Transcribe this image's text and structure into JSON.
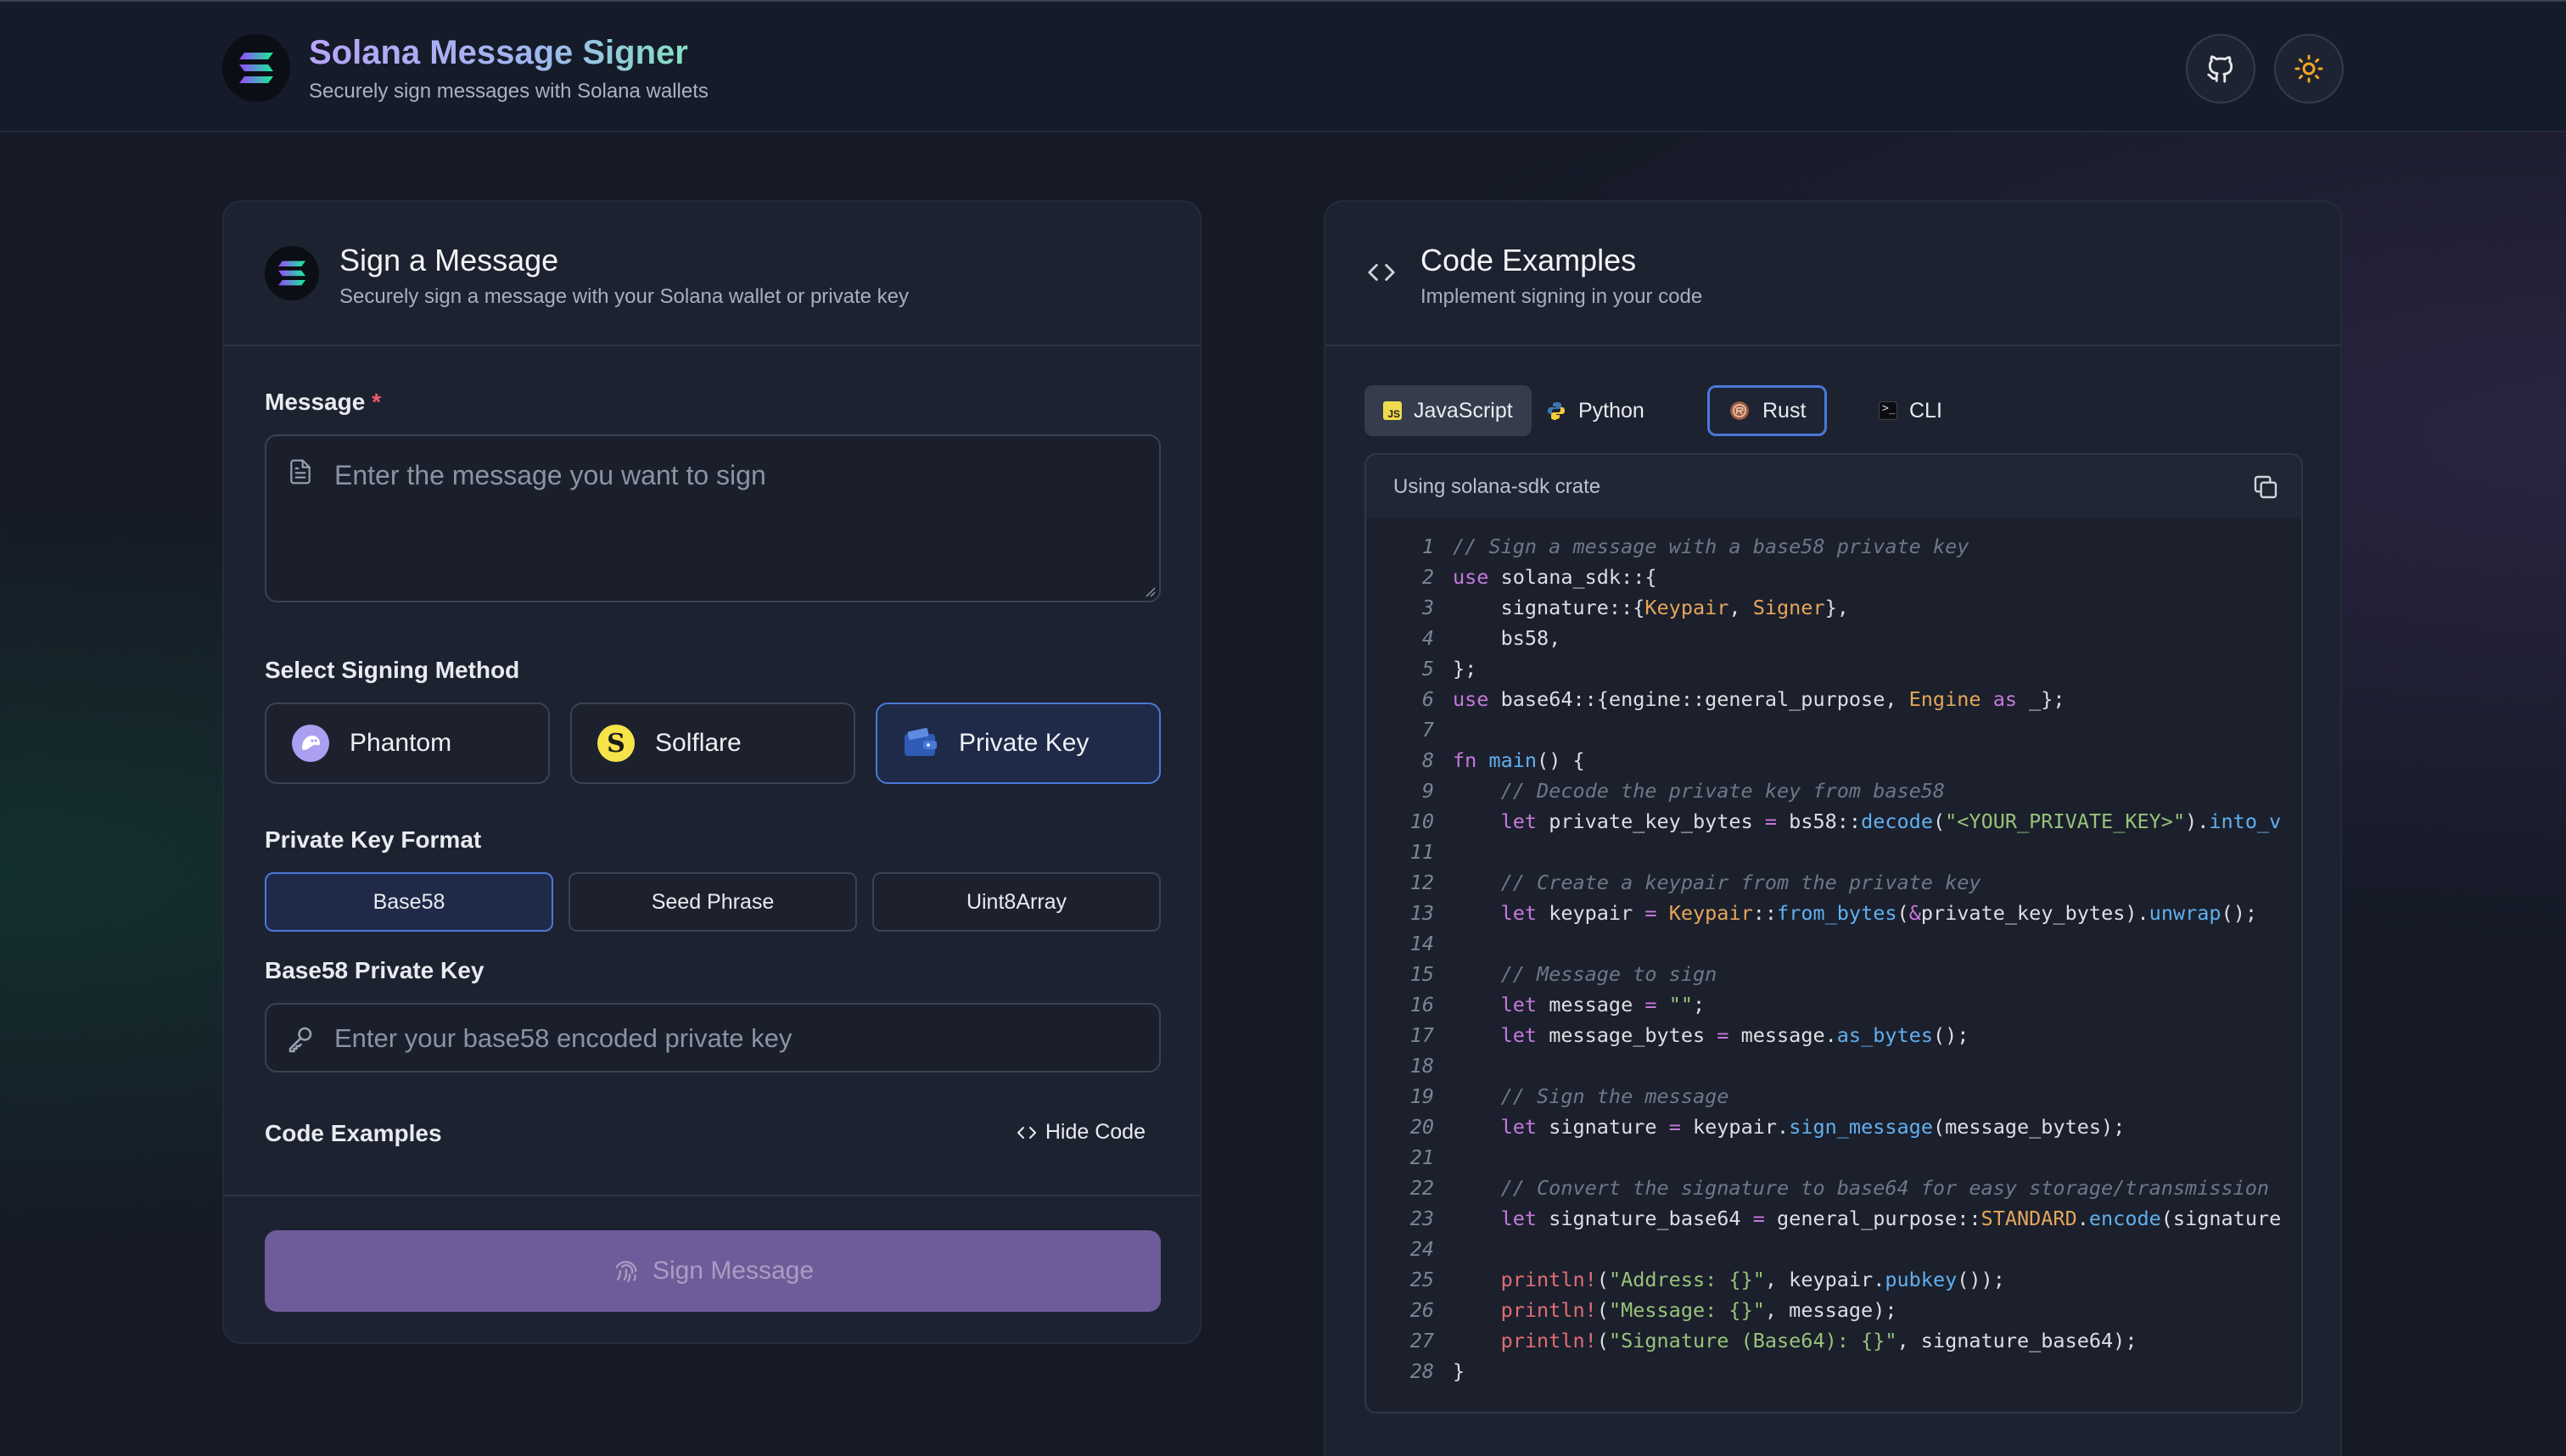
{
  "header": {
    "title": "Solana Message Signer",
    "subtitle": "Securely sign messages with Solana wallets",
    "github_icon": "github-icon",
    "theme_icon": "sun-icon"
  },
  "sign_card": {
    "title": "Sign a Message",
    "subtitle": "Securely sign a message with your Solana wallet or private key",
    "message_label": "Message",
    "required_mark": "*",
    "message_placeholder": "Enter the message you want to sign",
    "method_label": "Select Signing Method",
    "methods": [
      {
        "label": "Phantom",
        "icon": "phantom-icon"
      },
      {
        "label": "Solflare",
        "icon": "solflare-icon"
      },
      {
        "label": "Private Key",
        "icon": "wallet-icon",
        "selected": true
      }
    ],
    "format_label": "Private Key Format",
    "formats": [
      {
        "label": "Base58",
        "selected": true
      },
      {
        "label": "Seed Phrase"
      },
      {
        "label": "Uint8Array"
      }
    ],
    "key_label": "Base58 Private Key",
    "key_placeholder": "Enter your base58 encoded private key",
    "code_examples_label": "Code Examples",
    "hide_code_label": "Hide Code",
    "sign_button": "Sign Message"
  },
  "code_card": {
    "title": "Code Examples",
    "subtitle": "Implement signing in your code",
    "tabs": [
      {
        "label": "JavaScript",
        "icon": "javascript-icon"
      },
      {
        "label": "Python",
        "icon": "python-icon"
      },
      {
        "label": "Rust",
        "icon": "rust-icon",
        "selected": true
      },
      {
        "label": "CLI",
        "icon": "terminal-icon"
      }
    ],
    "caption": "Using solana-sdk crate",
    "lines": [
      [
        [
          "cm",
          "// Sign a message with a base58 private key"
        ]
      ],
      [
        [
          "kw",
          "use"
        ],
        [
          "tx",
          " solana_sdk::{"
        ]
      ],
      [
        [
          "tx",
          "    signature::{"
        ],
        [
          "ty",
          "Keypair"
        ],
        [
          "tx",
          ", "
        ],
        [
          "ty",
          "Signer"
        ],
        [
          "tx",
          "},"
        ]
      ],
      [
        [
          "tx",
          "    bs58,"
        ]
      ],
      [
        [
          "tx",
          "};"
        ]
      ],
      [
        [
          "kw",
          "use"
        ],
        [
          "tx",
          " base64::{engine::general_purpose, "
        ],
        [
          "ty",
          "Engine"
        ],
        [
          "tx",
          " "
        ],
        [
          "kw",
          "as"
        ],
        [
          "tx",
          " _};"
        ]
      ],
      [],
      [
        [
          "kw",
          "fn"
        ],
        [
          "tx",
          " "
        ],
        [
          "fn",
          "main"
        ],
        [
          "tx",
          "() {"
        ]
      ],
      [
        [
          "tx",
          "    "
        ],
        [
          "cm",
          "// Decode the private key from base58"
        ]
      ],
      [
        [
          "tx",
          "    "
        ],
        [
          "kw",
          "let"
        ],
        [
          "tx",
          " private_key_bytes "
        ],
        [
          "kw",
          "="
        ],
        [
          "tx",
          " bs58::"
        ],
        [
          "fn",
          "decode"
        ],
        [
          "tx",
          "("
        ],
        [
          "st",
          "\"<YOUR_PRIVATE_KEY>\""
        ],
        [
          "tx",
          ")."
        ],
        [
          "fn",
          "into_v"
        ]
      ],
      [],
      [
        [
          "tx",
          "    "
        ],
        [
          "cm",
          "// Create a keypair from the private key"
        ]
      ],
      [
        [
          "tx",
          "    "
        ],
        [
          "kw",
          "let"
        ],
        [
          "tx",
          " keypair "
        ],
        [
          "kw",
          "="
        ],
        [
          "tx",
          " "
        ],
        [
          "ty",
          "Keypair"
        ],
        [
          "tx",
          "::"
        ],
        [
          "fn",
          "from_bytes"
        ],
        [
          "tx",
          "("
        ],
        [
          "kw",
          "&"
        ],
        [
          "tx",
          "private_key_bytes)."
        ],
        [
          "fn",
          "unwrap"
        ],
        [
          "tx",
          "();"
        ]
      ],
      [],
      [
        [
          "tx",
          "    "
        ],
        [
          "cm",
          "// Message to sign"
        ]
      ],
      [
        [
          "tx",
          "    "
        ],
        [
          "kw",
          "let"
        ],
        [
          "tx",
          " message "
        ],
        [
          "kw",
          "="
        ],
        [
          "tx",
          " "
        ],
        [
          "st",
          "\"\""
        ],
        [
          "tx",
          ";"
        ]
      ],
      [
        [
          "tx",
          "    "
        ],
        [
          "kw",
          "let"
        ],
        [
          "tx",
          " message_bytes "
        ],
        [
          "kw",
          "="
        ],
        [
          "tx",
          " message."
        ],
        [
          "fn",
          "as_bytes"
        ],
        [
          "tx",
          "();"
        ]
      ],
      [],
      [
        [
          "tx",
          "    "
        ],
        [
          "cm",
          "// Sign the message"
        ]
      ],
      [
        [
          "tx",
          "    "
        ],
        [
          "kw",
          "let"
        ],
        [
          "tx",
          " signature "
        ],
        [
          "kw",
          "="
        ],
        [
          "tx",
          " keypair."
        ],
        [
          "fn",
          "sign_message"
        ],
        [
          "tx",
          "(message_bytes);"
        ]
      ],
      [],
      [
        [
          "tx",
          "    "
        ],
        [
          "cm",
          "// Convert the signature to base64 for easy storage/transmission"
        ]
      ],
      [
        [
          "tx",
          "    "
        ],
        [
          "kw",
          "let"
        ],
        [
          "tx",
          " signature_base64 "
        ],
        [
          "kw",
          "="
        ],
        [
          "tx",
          " general_purpose::"
        ],
        [
          "ty",
          "STANDARD"
        ],
        [
          "tx",
          "."
        ],
        [
          "fn",
          "encode"
        ],
        [
          "tx",
          "(signature"
        ]
      ],
      [],
      [
        [
          "tx",
          "    "
        ],
        [
          "mc",
          "println!"
        ],
        [
          "tx",
          "("
        ],
        [
          "st",
          "\"Address: {}\""
        ],
        [
          "tx",
          ", keypair."
        ],
        [
          "fn",
          "pubkey"
        ],
        [
          "tx",
          "());"
        ]
      ],
      [
        [
          "tx",
          "    "
        ],
        [
          "mc",
          "println!"
        ],
        [
          "tx",
          "("
        ],
        [
          "st",
          "\"Message: {}\""
        ],
        [
          "tx",
          ", message);"
        ]
      ],
      [
        [
          "tx",
          "    "
        ],
        [
          "mc",
          "println!"
        ],
        [
          "tx",
          "("
        ],
        [
          "st",
          "\"Signature (Base64): {}\""
        ],
        [
          "tx",
          ", signature_base64);"
        ]
      ],
      [
        [
          "tx",
          "}"
        ]
      ]
    ]
  },
  "colors": {
    "background": "#151a26",
    "card": "#1d2230",
    "accent_blue": "#4a78d8",
    "sign_button": "#6e5c9a",
    "required": "#ef5a6f"
  }
}
